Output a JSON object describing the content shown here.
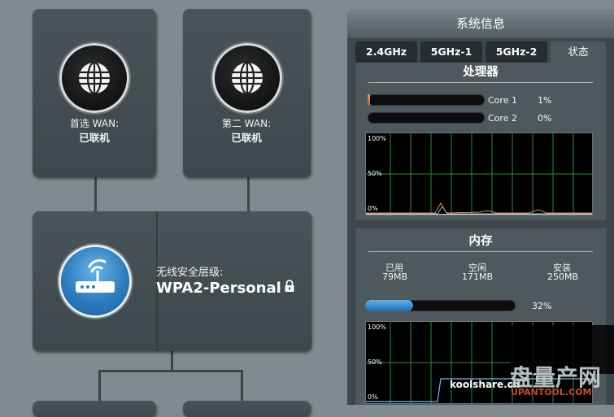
{
  "wan": [
    {
      "label": "首选 WAN:",
      "status": "已联机"
    },
    {
      "label": "第二 WAN:",
      "status": "已联机"
    }
  ],
  "security": {
    "label": "无线安全层级:",
    "value": "WPA2-Personal"
  },
  "sysinfo": {
    "title": "系统信息",
    "tabs": [
      "2.4GHz",
      "5GHz-1",
      "5GHz-2",
      "状态"
    ],
    "active_tab": "状态",
    "cpu": {
      "title": "处理器",
      "cores": [
        {
          "name": "Core 1",
          "percent": "1%",
          "fraction": 0.01
        },
        {
          "name": "Core 2",
          "percent": "0%",
          "fraction": 0.0
        }
      ],
      "graph_ticks": [
        "100%",
        "50%",
        "0%"
      ]
    },
    "memory": {
      "title": "内存",
      "used_label": "已用",
      "used_value": "79MB",
      "free_label": "空闲",
      "free_value": "171MB",
      "installed_label": "安装",
      "installed_value": "250MB",
      "percent": "32%",
      "fraction": 0.32,
      "graph_ticks": [
        "100%",
        "50%",
        "0%"
      ]
    }
  },
  "watermark": {
    "text1": "koolshare.cn",
    "text2": "盘量产网",
    "text3": "UPANTOOL.COM"
  },
  "colors": {
    "cpu_bar": "#c2561c",
    "mem_bar": "#1f6fb1",
    "grid": "#2f8a3a"
  }
}
